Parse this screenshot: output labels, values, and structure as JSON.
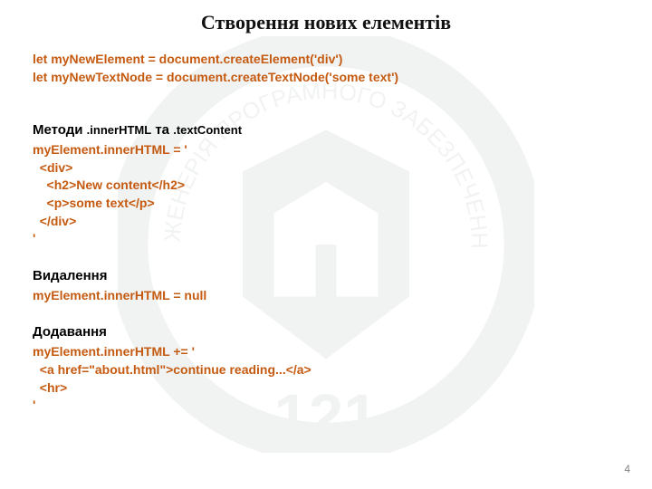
{
  "title": "Створення нових елементів",
  "code_top": [
    "let myNewElement = document.createElement('div')",
    "let myNewTextNode = document.createTextNode('some text')"
  ],
  "section1": {
    "heading": "Методи ",
    "heading_mono1": ".innerHTML",
    "heading_mid": " та ",
    "heading_mono2": ".textContent",
    "code": [
      "myElement.innerHTML = '",
      "  <div>",
      "    <h2>New content</h2>",
      "    <p>some text</p>",
      "  </div>",
      "'"
    ]
  },
  "section2": {
    "heading": "Видалення",
    "code": [
      "myElement.innerHTML = null"
    ]
  },
  "section3": {
    "heading": "Додавання",
    "code": [
      "myElement.innerHTML += '",
      "  <a href=\"about.html\">continue reading...</a>",
      "  <hr>",
      "'"
    ]
  },
  "page_number": "4"
}
